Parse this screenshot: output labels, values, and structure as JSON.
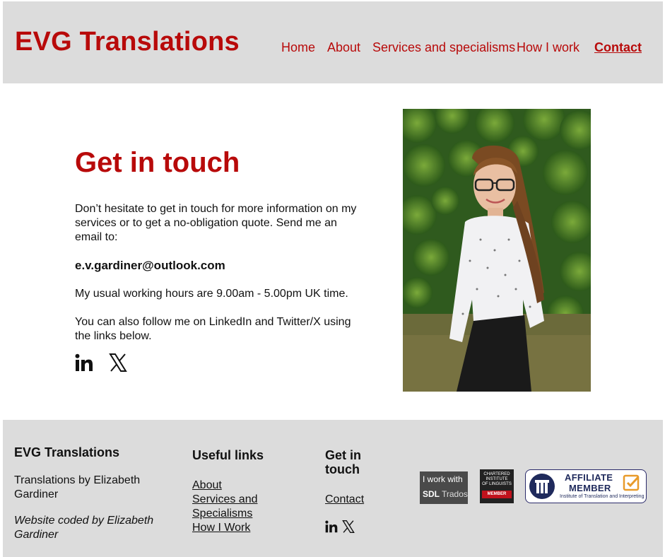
{
  "header": {
    "brand": "EVG Translations",
    "nav": [
      {
        "label": "Home",
        "active": false
      },
      {
        "label": "About",
        "active": false
      },
      {
        "label": "Services and specialisms",
        "active": false
      },
      {
        "label": "How I work",
        "active": false
      },
      {
        "label": "Contact",
        "active": true
      }
    ]
  },
  "main": {
    "title": "Get in touch",
    "intro": "Don’t hesitate to get in touch for more information on my services or to get a no-obligation quote. Send me an email to:",
    "email": "e.v.gardiner@outlook.com",
    "hours": "My usual working hours are 9.00am - 5.00pm UK time.",
    "follow": "You can also follow me on LinkedIn and Twitter/X using the links below.",
    "social_icons": [
      "linkedin-icon",
      "x-icon"
    ]
  },
  "footer": {
    "brand": "EVG Translations",
    "tagline": "Translations by Elizabeth Gardiner",
    "credit": "Website coded by Elizabeth Gardiner",
    "useful_links_title": "Useful links",
    "useful_links": [
      "About",
      "Services and Specialisms",
      "How I Work"
    ],
    "get_in_touch_title": "Get in touch",
    "contact_link": "Contact",
    "badges": {
      "trados_line1": "I work with",
      "trados_line2": "SDL",
      "trados_line3": "Trados",
      "ciol_line1": "CHARTERED",
      "ciol_line2": "INSTITUTE",
      "ciol_line3": "OF LINGUISTS",
      "ciol_member": "MEMBER",
      "iti_line1": "AFFILIATE",
      "iti_line2": "MEMBER",
      "iti_line3": "Institute of Translation and Interpreting"
    }
  },
  "colors": {
    "brand_red": "#b80a0a",
    "header_bg": "#dcdcdc",
    "footer_bg": "#dcdcdc"
  }
}
